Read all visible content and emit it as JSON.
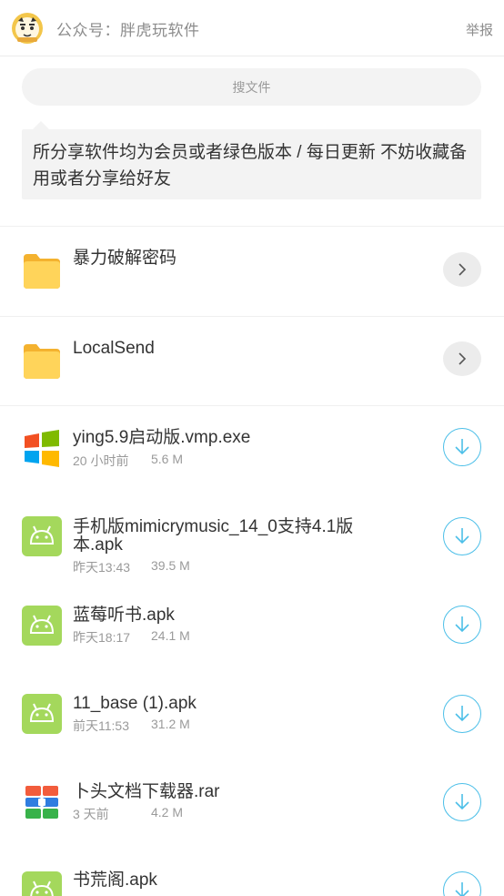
{
  "header": {
    "account_title": "公众号：胖虎玩软件",
    "report_label": "举报"
  },
  "search": {
    "placeholder": "搜文件"
  },
  "notice": {
    "text": "所分享软件均为会员或者绿色版本 / 每日更新 不妨收藏备用或者分享给好友"
  },
  "folders": [
    {
      "name": "暴力破解密码",
      "icon": "folder-icon"
    },
    {
      "name": "LocalSend",
      "icon": "folder-icon"
    }
  ],
  "files": [
    {
      "name": "ying5.9启动版.vmp.exe",
      "time": "20 小时前",
      "size": "5.6 M",
      "icon": "windows-icon"
    },
    {
      "name": "手机版mimicrymusic_14_0支持4.1版本.apk",
      "time": "昨天13:43",
      "size": "39.5 M",
      "icon": "android-icon"
    },
    {
      "name": "蓝莓听书.apk",
      "time": "昨天18:17",
      "size": "24.1 M",
      "icon": "android-icon"
    },
    {
      "name": "11_base (1).apk",
      "time": "前天11:53",
      "size": "31.2 M",
      "icon": "android-icon"
    },
    {
      "name": "卜头文档下载器.rar",
      "time": "3 天前",
      "size": "4.2 M",
      "icon": "archive-icon"
    },
    {
      "name": "书荒阁.apk",
      "time": "",
      "size": "",
      "icon": "android-icon"
    }
  ],
  "colors": {
    "folder": "#ffcf4a",
    "android": "#a4d85c",
    "download_accent": "#4cbfe8"
  }
}
